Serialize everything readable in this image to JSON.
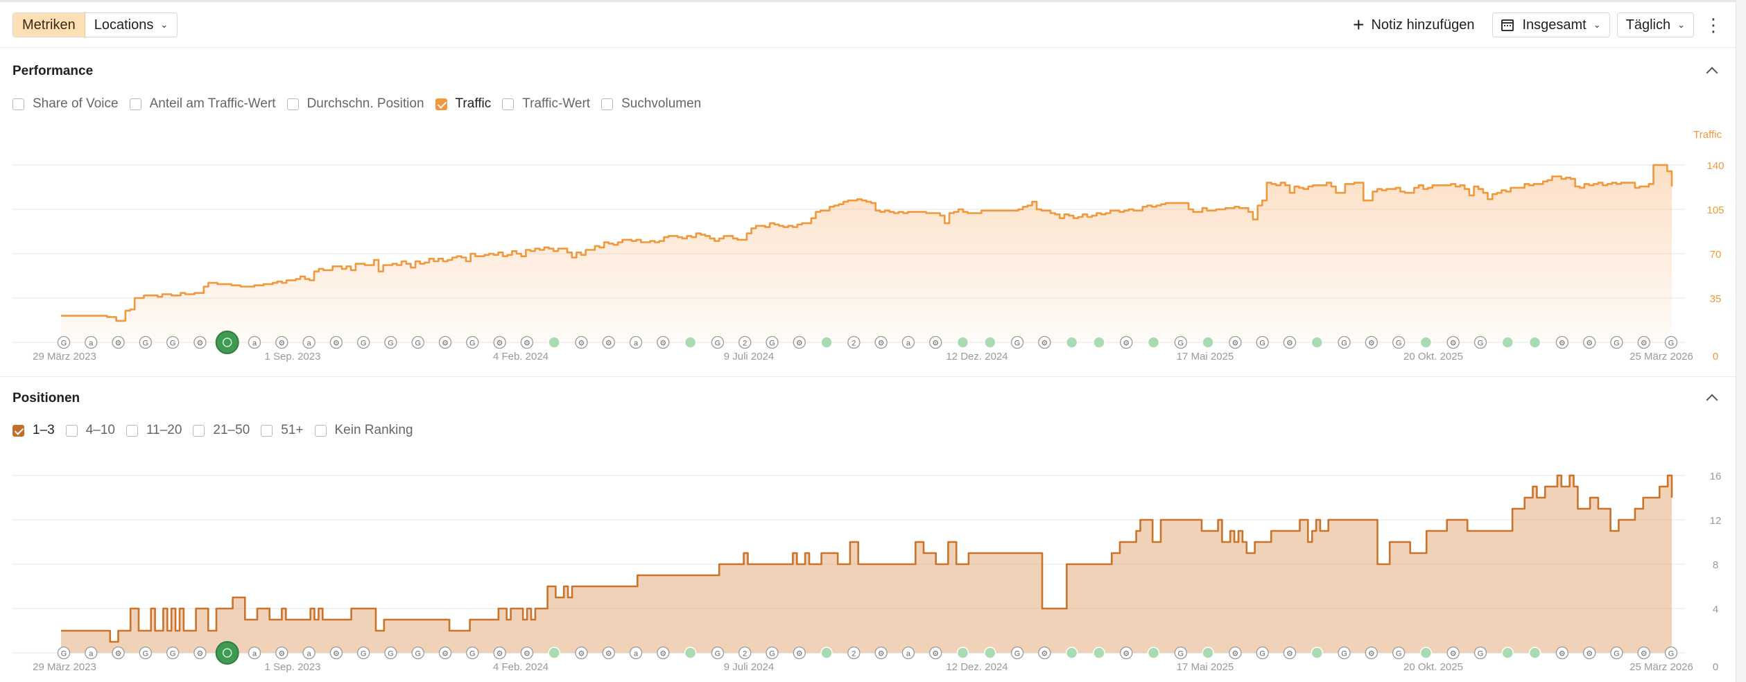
{
  "toolbar": {
    "tabs": [
      {
        "label": "Metriken",
        "active": true
      },
      {
        "label": "Locations",
        "active": false
      }
    ],
    "add_note_label": "Notiz hinzufügen",
    "range_label": "Insgesamt",
    "interval_label": "Täglich"
  },
  "colors": {
    "accent": "#f0983a",
    "accent_dark": "#c9742a",
    "tab_active_bg": "#fde0b5",
    "check_traffic": "#f0983a",
    "check_positions": "#c27027",
    "gridline": "#eeeeee",
    "marker_green": "#59b76a"
  },
  "performance": {
    "title": "Performance",
    "metrics": [
      {
        "label": "Share of Voice",
        "checked": false
      },
      {
        "label": "Anteil am Traffic-Wert",
        "checked": false
      },
      {
        "label": "Durchschn. Position",
        "checked": false
      },
      {
        "label": "Traffic",
        "checked": true
      },
      {
        "label": "Traffic-Wert",
        "checked": false
      },
      {
        "label": "Suchvolumen",
        "checked": false
      }
    ]
  },
  "positions": {
    "title": "Positionen",
    "buckets": [
      {
        "label": "1–3",
        "checked": true
      },
      {
        "label": "4–10",
        "checked": false
      },
      {
        "label": "11–20",
        "checked": false
      },
      {
        "label": "21–50",
        "checked": false
      },
      {
        "label": "51+",
        "checked": false
      },
      {
        "label": "Kein Ranking",
        "checked": false
      }
    ]
  },
  "chart_data": [
    {
      "type": "area",
      "series": [
        {
          "name": "Traffic",
          "values": [
            21,
            21,
            21,
            21,
            21,
            21,
            21,
            21,
            21,
            21,
            20,
            20,
            17,
            17,
            25,
            26,
            35,
            35,
            37,
            37,
            37,
            36,
            38,
            38,
            37,
            37,
            39,
            38,
            38,
            39,
            39,
            44,
            47,
            47,
            46,
            46,
            46,
            45,
            45,
            44,
            44,
            44,
            45,
            45,
            46,
            46,
            47,
            48,
            47,
            49,
            49,
            50,
            52,
            50,
            49,
            56,
            58,
            57,
            57,
            60,
            60,
            58,
            60,
            57,
            62,
            62,
            61,
            61,
            65,
            56,
            61,
            61,
            62,
            61,
            64,
            62,
            59,
            64,
            62,
            63,
            66,
            64,
            66,
            64,
            65,
            67,
            68,
            67,
            64,
            70,
            68,
            68,
            69,
            70,
            69,
            71,
            68,
            69,
            72,
            70,
            68,
            73,
            72,
            74,
            73,
            75,
            74,
            72,
            74,
            74,
            71,
            67,
            71,
            69,
            73,
            73,
            76,
            75,
            79,
            78,
            77,
            79,
            81,
            81,
            80,
            81,
            79,
            79,
            80,
            79,
            80,
            83,
            84,
            84,
            83,
            82,
            84,
            83,
            86,
            85,
            84,
            82,
            80,
            82,
            84,
            84,
            82,
            81,
            81,
            86,
            90,
            92,
            92,
            91,
            94,
            93,
            92,
            91,
            92,
            91,
            93,
            94,
            94,
            98,
            103,
            104,
            104,
            107,
            108,
            109,
            111,
            112,
            112,
            113,
            112,
            111,
            110,
            104,
            103,
            104,
            103,
            102,
            103,
            102,
            103,
            103,
            103,
            103,
            102,
            102,
            102,
            100,
            94,
            102,
            103,
            105,
            103,
            102,
            102,
            102,
            104,
            104,
            104,
            104,
            104,
            104,
            104,
            104,
            105,
            107,
            108,
            111,
            105,
            104,
            104,
            102,
            101,
            98,
            101,
            100,
            98,
            99,
            101,
            99,
            100,
            102,
            101,
            102,
            104,
            104,
            103,
            104,
            105,
            104,
            104,
            107,
            108,
            107,
            108,
            109,
            110,
            110,
            110,
            110,
            110,
            105,
            103,
            103,
            106,
            104,
            104,
            105,
            105,
            106,
            106,
            107,
            106,
            106,
            103,
            97,
            108,
            112,
            126,
            125,
            124,
            126,
            124,
            118,
            123,
            122,
            121,
            123,
            124,
            124,
            124,
            126,
            123,
            118,
            118,
            125,
            125,
            126,
            126,
            112,
            112,
            119,
            121,
            120,
            121,
            121,
            122,
            119,
            118,
            118,
            122,
            124,
            121,
            122,
            124,
            124,
            124,
            124,
            125,
            123,
            124,
            121,
            116,
            123,
            121,
            118,
            113,
            117,
            118,
            120,
            119,
            122,
            122,
            122,
            125,
            124,
            125,
            125,
            127,
            128,
            131,
            131,
            129,
            130,
            129,
            123,
            122,
            125,
            124,
            125,
            126,
            124,
            125,
            126,
            125,
            126,
            126,
            126,
            122,
            123,
            123,
            125,
            140,
            140,
            140,
            135,
            123
          ]
        }
      ],
      "y_axis": {
        "label": "Traffic",
        "ticks": [
          "0",
          "35",
          "70",
          "105",
          "140"
        ],
        "ylim": [
          0,
          140
        ],
        "position": "right"
      },
      "x_tick_labels": [
        "29 März 2023",
        "1 Sep. 2023",
        "4 Feb. 2024",
        "9 Juli 2024",
        "12 Dez. 2024",
        "17 Mai 2025",
        "20 Okt. 2025",
        "25 März 2026"
      ],
      "grid": true
    },
    {
      "type": "area",
      "series": [
        {
          "name": "1–3",
          "values": [
            2,
            2,
            2,
            2,
            2,
            2,
            2,
            2,
            2,
            2,
            2,
            2,
            1,
            1,
            2,
            2,
            2,
            4,
            4,
            2,
            2,
            2,
            4,
            2,
            2,
            4,
            2,
            4,
            2,
            4,
            2,
            2,
            2,
            4,
            4,
            4,
            2,
            2,
            4,
            4,
            4,
            4,
            5,
            5,
            5,
            3,
            3,
            3,
            4,
            4,
            4,
            3,
            3,
            3,
            4,
            3,
            3,
            3,
            3,
            3,
            3,
            4,
            3,
            4,
            3,
            3,
            3,
            3,
            3,
            3,
            3,
            4,
            4,
            4,
            4,
            4,
            4,
            2,
            2,
            3,
            3,
            3,
            3,
            3,
            3,
            3,
            3,
            3,
            3,
            3,
            3,
            3,
            3,
            3,
            3,
            2,
            2,
            2,
            2,
            2,
            3,
            3,
            3,
            3,
            3,
            3,
            3,
            4,
            4,
            3,
            4,
            4,
            4,
            3,
            4,
            3,
            4,
            4,
            4,
            6,
            6,
            5,
            5,
            6,
            5,
            6,
            6,
            6,
            6,
            6,
            6,
            6,
            6,
            6,
            6,
            6,
            6,
            6,
            6,
            6,
            6,
            7,
            7,
            7,
            7,
            7,
            7,
            7,
            7,
            7,
            7,
            7,
            7,
            7,
            7,
            7,
            7,
            7,
            7,
            7,
            7,
            8,
            8,
            8,
            8,
            8,
            8,
            9,
            8,
            8,
            8,
            8,
            8,
            8,
            8,
            8,
            8,
            8,
            8,
            9,
            8,
            8,
            9,
            8,
            8,
            8,
            9,
            9,
            9,
            9,
            8,
            8,
            8,
            10,
            10,
            8,
            8,
            8,
            8,
            8,
            8,
            8,
            8,
            8,
            8,
            8,
            8,
            8,
            8,
            10,
            10,
            9,
            9,
            9,
            8,
            8,
            8,
            10,
            10,
            8,
            8,
            8,
            9,
            9,
            9,
            9,
            9,
            9,
            9,
            9,
            9,
            9,
            9,
            9,
            9,
            9,
            9,
            9,
            9,
            9,
            4,
            4,
            4,
            4,
            4,
            4,
            8,
            8,
            8,
            8,
            8,
            8,
            8,
            8,
            8,
            8,
            8,
            9,
            9,
            10,
            10,
            10,
            10,
            11,
            12,
            12,
            12,
            10,
            10,
            12,
            12,
            12,
            12,
            12,
            12,
            12,
            12,
            12,
            12,
            11,
            11,
            11,
            11,
            12,
            10,
            10,
            11,
            10,
            11,
            10,
            9,
            9,
            10,
            10,
            10,
            10,
            11,
            11,
            11,
            11,
            11,
            11,
            11,
            12,
            12,
            10,
            11,
            12,
            11,
            11,
            12,
            12,
            12,
            12,
            12,
            12,
            12,
            12,
            12,
            12,
            12,
            12,
            8,
            8,
            8,
            10,
            10,
            10,
            10,
            10,
            9,
            9,
            9,
            9,
            11,
            11,
            11,
            11,
            11,
            12,
            12,
            12,
            12,
            12,
            11,
            11,
            11,
            11,
            11,
            11,
            11,
            11,
            11,
            11,
            11,
            13,
            13,
            13,
            14,
            14,
            15,
            14,
            14,
            15,
            15,
            15,
            16,
            15,
            15,
            16,
            15,
            13,
            13,
            13,
            14,
            14,
            13,
            13,
            13,
            11,
            11,
            12,
            12,
            12,
            12,
            13,
            13,
            14,
            14,
            14,
            14,
            15,
            15,
            16,
            14
          ]
        }
      ],
      "y_axis": {
        "label": "",
        "ticks": [
          "0",
          "4",
          "8",
          "12",
          "16"
        ],
        "ylim": [
          0,
          16
        ],
        "position": "right"
      },
      "x_tick_labels": [
        "29 März 2023",
        "1 Sep. 2023",
        "4 Feb. 2024",
        "9 Juli 2024",
        "12 Dez. 2024",
        "17 Mai 2025",
        "20 Okt. 2025",
        "25 März 2026"
      ],
      "grid": true
    }
  ],
  "annotation_markers": [
    {
      "symbol": "G"
    },
    {
      "symbol": "a"
    },
    {
      "symbol": "gear"
    },
    {
      "symbol": "G"
    },
    {
      "symbol": "G"
    },
    {
      "symbol": "gear"
    },
    {
      "symbol": "big-green"
    },
    {
      "symbol": "a"
    },
    {
      "symbol": "gear"
    },
    {
      "symbol": "a"
    },
    {
      "symbol": "gear"
    },
    {
      "symbol": "G"
    },
    {
      "symbol": "G"
    },
    {
      "symbol": "G"
    },
    {
      "symbol": "gear"
    },
    {
      "symbol": "G"
    },
    {
      "symbol": "gear"
    },
    {
      "symbol": "gear"
    },
    {
      "symbol": "green"
    },
    {
      "symbol": "gear"
    },
    {
      "symbol": "gear"
    },
    {
      "symbol": "a"
    },
    {
      "symbol": "gear"
    },
    {
      "symbol": "green"
    },
    {
      "symbol": "G"
    },
    {
      "symbol": "2"
    },
    {
      "symbol": "G"
    },
    {
      "symbol": "gear"
    },
    {
      "symbol": "green"
    },
    {
      "symbol": "2"
    },
    {
      "symbol": "gear"
    },
    {
      "symbol": "a"
    },
    {
      "symbol": "gear"
    },
    {
      "symbol": "green"
    },
    {
      "symbol": "green"
    },
    {
      "symbol": "G"
    },
    {
      "symbol": "gear"
    },
    {
      "symbol": "green"
    },
    {
      "symbol": "green"
    },
    {
      "symbol": "gear"
    },
    {
      "symbol": "green"
    },
    {
      "symbol": "G"
    },
    {
      "symbol": "green"
    },
    {
      "symbol": "gear"
    },
    {
      "symbol": "G"
    },
    {
      "symbol": "gear"
    },
    {
      "symbol": "green"
    },
    {
      "symbol": "G"
    },
    {
      "symbol": "gear"
    },
    {
      "symbol": "G"
    },
    {
      "symbol": "green"
    },
    {
      "symbol": "gear"
    },
    {
      "symbol": "G"
    },
    {
      "symbol": "green"
    },
    {
      "symbol": "green"
    },
    {
      "symbol": "gear"
    },
    {
      "symbol": "gear"
    },
    {
      "symbol": "G"
    },
    {
      "symbol": "gear"
    },
    {
      "symbol": "G"
    }
  ]
}
